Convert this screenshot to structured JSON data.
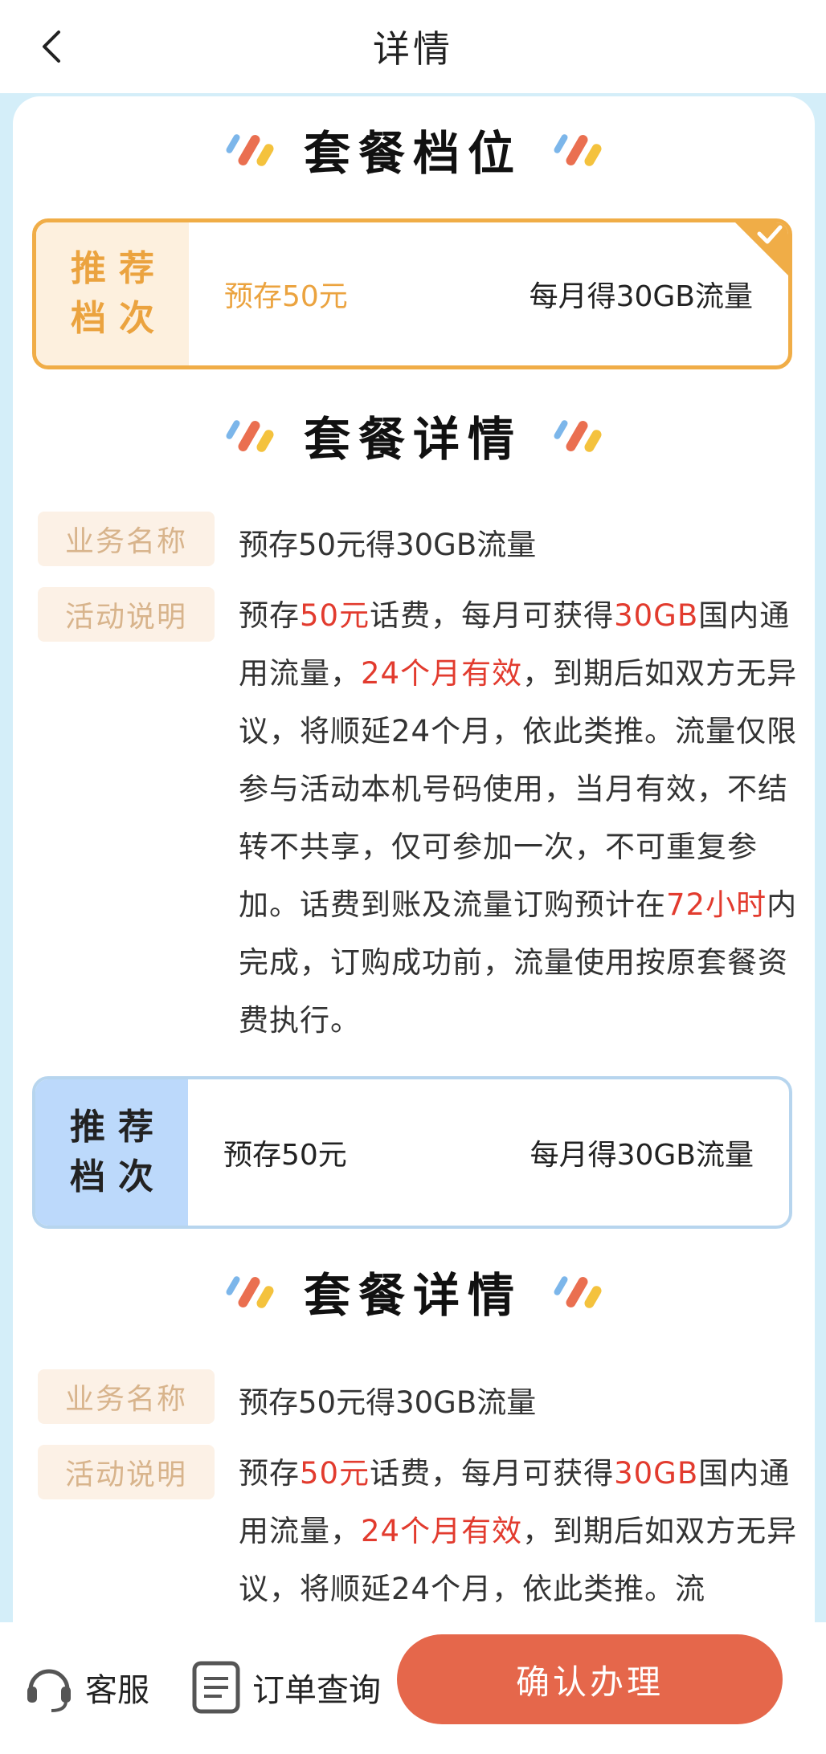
{
  "header": {
    "title": "详情"
  },
  "section_tier": {
    "title": "套餐档位"
  },
  "tier_selected": {
    "label": "推荐档次",
    "deposit": "预存50元",
    "data": "每月得30GB流量"
  },
  "detail1": {
    "title": "套餐详情",
    "name_tag": "业务名称",
    "name_value": "预存50元得30GB流量",
    "desc_tag": "活动说明",
    "desc": {
      "p1": "预存",
      "h1": "50元",
      "p2": "话费，每月可获得",
      "h2": "30GB",
      "p3": "国内通用流量，",
      "h3": "24个月有效",
      "p4": "，到期后如双方无异议，将顺延24个月，依此类推。流量仅限参与活动本机号码使用，当月有效，不结转不共享，仅可参加一次，不可重复参加。话费到账及流量订购预计在",
      "h4": "72小时",
      "p5": "内完成，订购成功前，流量使用按原套餐资费执行。"
    }
  },
  "tier_second": {
    "label": "推荐档次",
    "deposit": "预存50元",
    "data": "每月得30GB流量"
  },
  "detail2": {
    "title": "套餐详情",
    "name_tag": "业务名称",
    "name_value": "预存50元得30GB流量",
    "desc_tag": "活动说明",
    "desc": {
      "p1": "预存",
      "h1": "50元",
      "p2": "话费，每月可获得",
      "h2": "30GB",
      "p3": "国内通用流量，",
      "h3": "24个月有效",
      "p4": "，到期后如双方无异议，将顺延24个月，依此类推。流"
    }
  },
  "bottom": {
    "service": "客服",
    "orders": "订单查询",
    "confirm": "确认办理"
  },
  "colors": {
    "accent": "#e5674b",
    "highlight": "#e23b2e",
    "selected_border": "#f0ad47",
    "page_bg": "#d4eef9"
  }
}
